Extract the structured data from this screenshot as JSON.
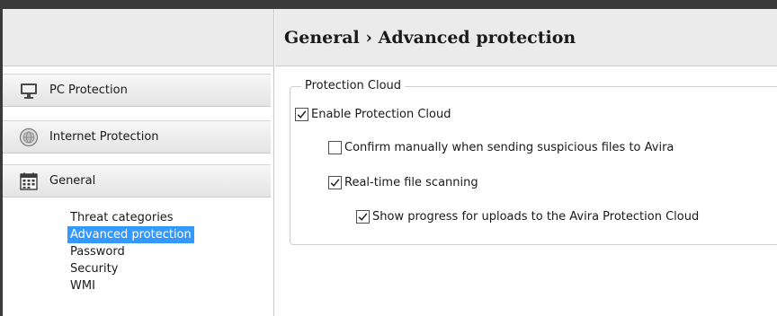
{
  "breadcrumb": "General › Advanced protection",
  "sidebar": {
    "sections": [
      {
        "label": "PC Protection",
        "icon": "monitor-icon"
      },
      {
        "label": "Internet Protection",
        "icon": "globe-icon"
      },
      {
        "label": "General",
        "icon": "calendar-icon"
      }
    ],
    "general_items": [
      {
        "label": "Threat categories",
        "selected": false
      },
      {
        "label": "Advanced protection",
        "selected": true
      },
      {
        "label": "Password",
        "selected": false
      },
      {
        "label": "Security",
        "selected": false
      },
      {
        "label": "WMI",
        "selected": false
      }
    ]
  },
  "protection_cloud": {
    "group_title": "Protection Cloud",
    "options": [
      {
        "label": "Enable Protection Cloud",
        "checked": true
      },
      {
        "label": "Confirm manually when sending suspicious files to Avira",
        "checked": false
      },
      {
        "label": "Real-time file scanning",
        "checked": true
      },
      {
        "label": "Show progress for uploads to the Avira Protection Cloud",
        "checked": true
      }
    ]
  },
  "colors": {
    "selection": "#3399ff",
    "header_bg": "#ebebeb",
    "frame": "#3a3a3a"
  }
}
